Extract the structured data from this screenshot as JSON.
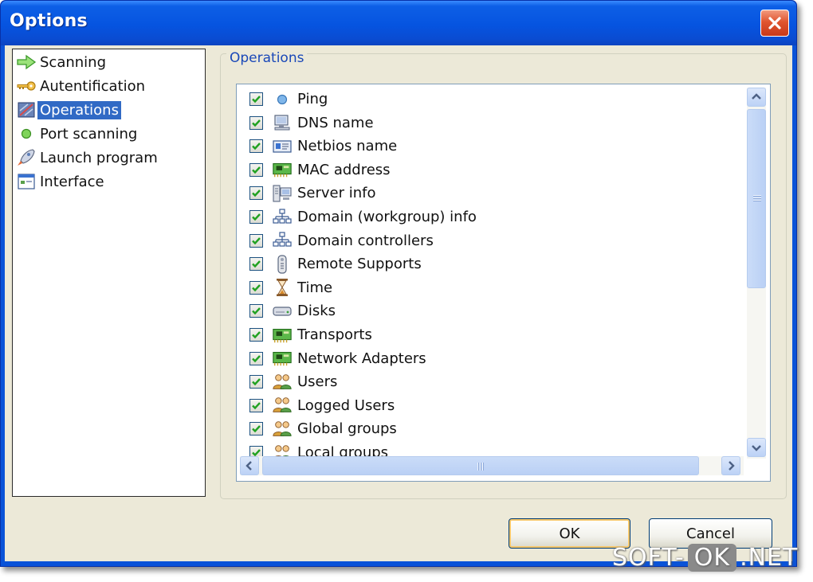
{
  "window": {
    "title": "Options"
  },
  "nav": {
    "items": [
      {
        "label": "Scanning",
        "icon": "arrow-right-icon"
      },
      {
        "label": "Autentification",
        "icon": "key-icon"
      },
      {
        "label": "Operations",
        "icon": "operations-icon",
        "selected": true
      },
      {
        "label": "Port scanning",
        "icon": "green-dot-icon"
      },
      {
        "label": "Launch program",
        "icon": "rocket-icon"
      },
      {
        "label": "Interface",
        "icon": "window-icon"
      }
    ]
  },
  "operations": {
    "group_title": "Operations",
    "items": [
      {
        "label": "Ping",
        "checked": true,
        "icon": "blue-dot-icon"
      },
      {
        "label": "DNS name",
        "checked": true,
        "icon": "computer-icon"
      },
      {
        "label": "Netbios name",
        "checked": true,
        "icon": "id-card-icon"
      },
      {
        "label": "MAC address",
        "checked": true,
        "icon": "network-card-icon"
      },
      {
        "label": "Server info",
        "checked": true,
        "icon": "server-icon"
      },
      {
        "label": "Domain (workgroup) info",
        "checked": true,
        "icon": "domain-tree-icon"
      },
      {
        "label": "Domain controllers",
        "checked": true,
        "icon": "domain-tree-icon"
      },
      {
        "label": "Remote Supports",
        "checked": true,
        "icon": "remote-icon"
      },
      {
        "label": "Time",
        "checked": true,
        "icon": "hourglass-icon"
      },
      {
        "label": "Disks",
        "checked": true,
        "icon": "disk-icon"
      },
      {
        "label": "Transports",
        "checked": true,
        "icon": "network-card-icon"
      },
      {
        "label": "Network Adapters",
        "checked": true,
        "icon": "network-card-icon"
      },
      {
        "label": "Users",
        "checked": true,
        "icon": "users-icon"
      },
      {
        "label": "Logged Users",
        "checked": true,
        "icon": "users-icon"
      },
      {
        "label": "Global groups",
        "checked": true,
        "icon": "users-icon"
      },
      {
        "label": "Local groups",
        "checked": true,
        "icon": "users-icon"
      }
    ]
  },
  "buttons": {
    "ok": "OK",
    "cancel": "Cancel"
  },
  "watermark": {
    "left": "SOFT-",
    "middle": "OK",
    "right": ".NET"
  },
  "colors": {
    "selection": "#316ac5",
    "title_bar": "#0654e0",
    "dialog_bg": "#ece9d8",
    "group_title": "#1a48b8"
  }
}
